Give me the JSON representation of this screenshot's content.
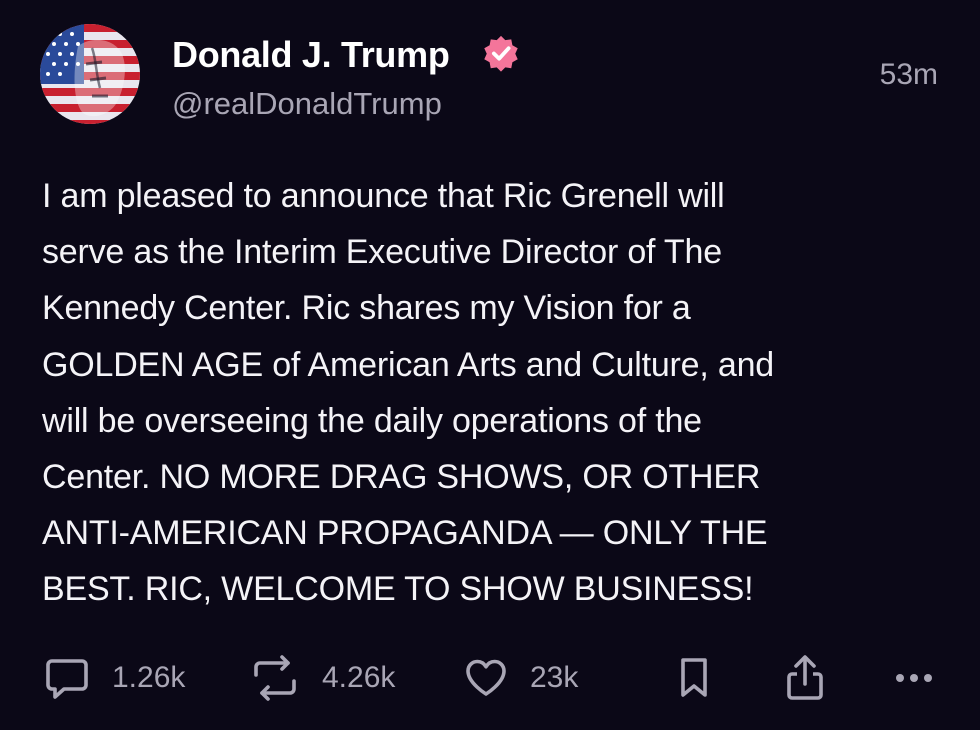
{
  "author": {
    "display_name": "Donald J. Trump",
    "handle": "@realDonaldTrump",
    "verified": true,
    "verified_color": "#f4759a"
  },
  "timestamp": "53m",
  "post": {
    "lines": [
      "I am pleased to announce that Ric Grenell will",
      "serve as the Interim Executive Director of The",
      "Kennedy Center. Ric shares my Vision for a",
      "GOLDEN AGE of American Arts and Culture, and",
      "will be overseeing the daily operations of the",
      "Center. NO MORE DRAG SHOWS, OR OTHER",
      "ANTI-AMERICAN PROPAGANDA — ONLY THE",
      "BEST. RIC, WELCOME TO SHOW BUSINESS!"
    ]
  },
  "actions": {
    "replies": {
      "icon": "comment-icon",
      "count": "1.26k"
    },
    "reposts": {
      "icon": "repost-icon",
      "count": "4.26k"
    },
    "likes": {
      "icon": "heart-icon",
      "count": "23k"
    },
    "bookmark": {
      "icon": "bookmark-icon"
    },
    "share": {
      "icon": "share-icon"
    },
    "more": {
      "icon": "more-icon"
    }
  },
  "colors": {
    "background": "#0b0817",
    "text_primary": "#f4f3f7",
    "text_secondary": "#a9a6b5"
  }
}
